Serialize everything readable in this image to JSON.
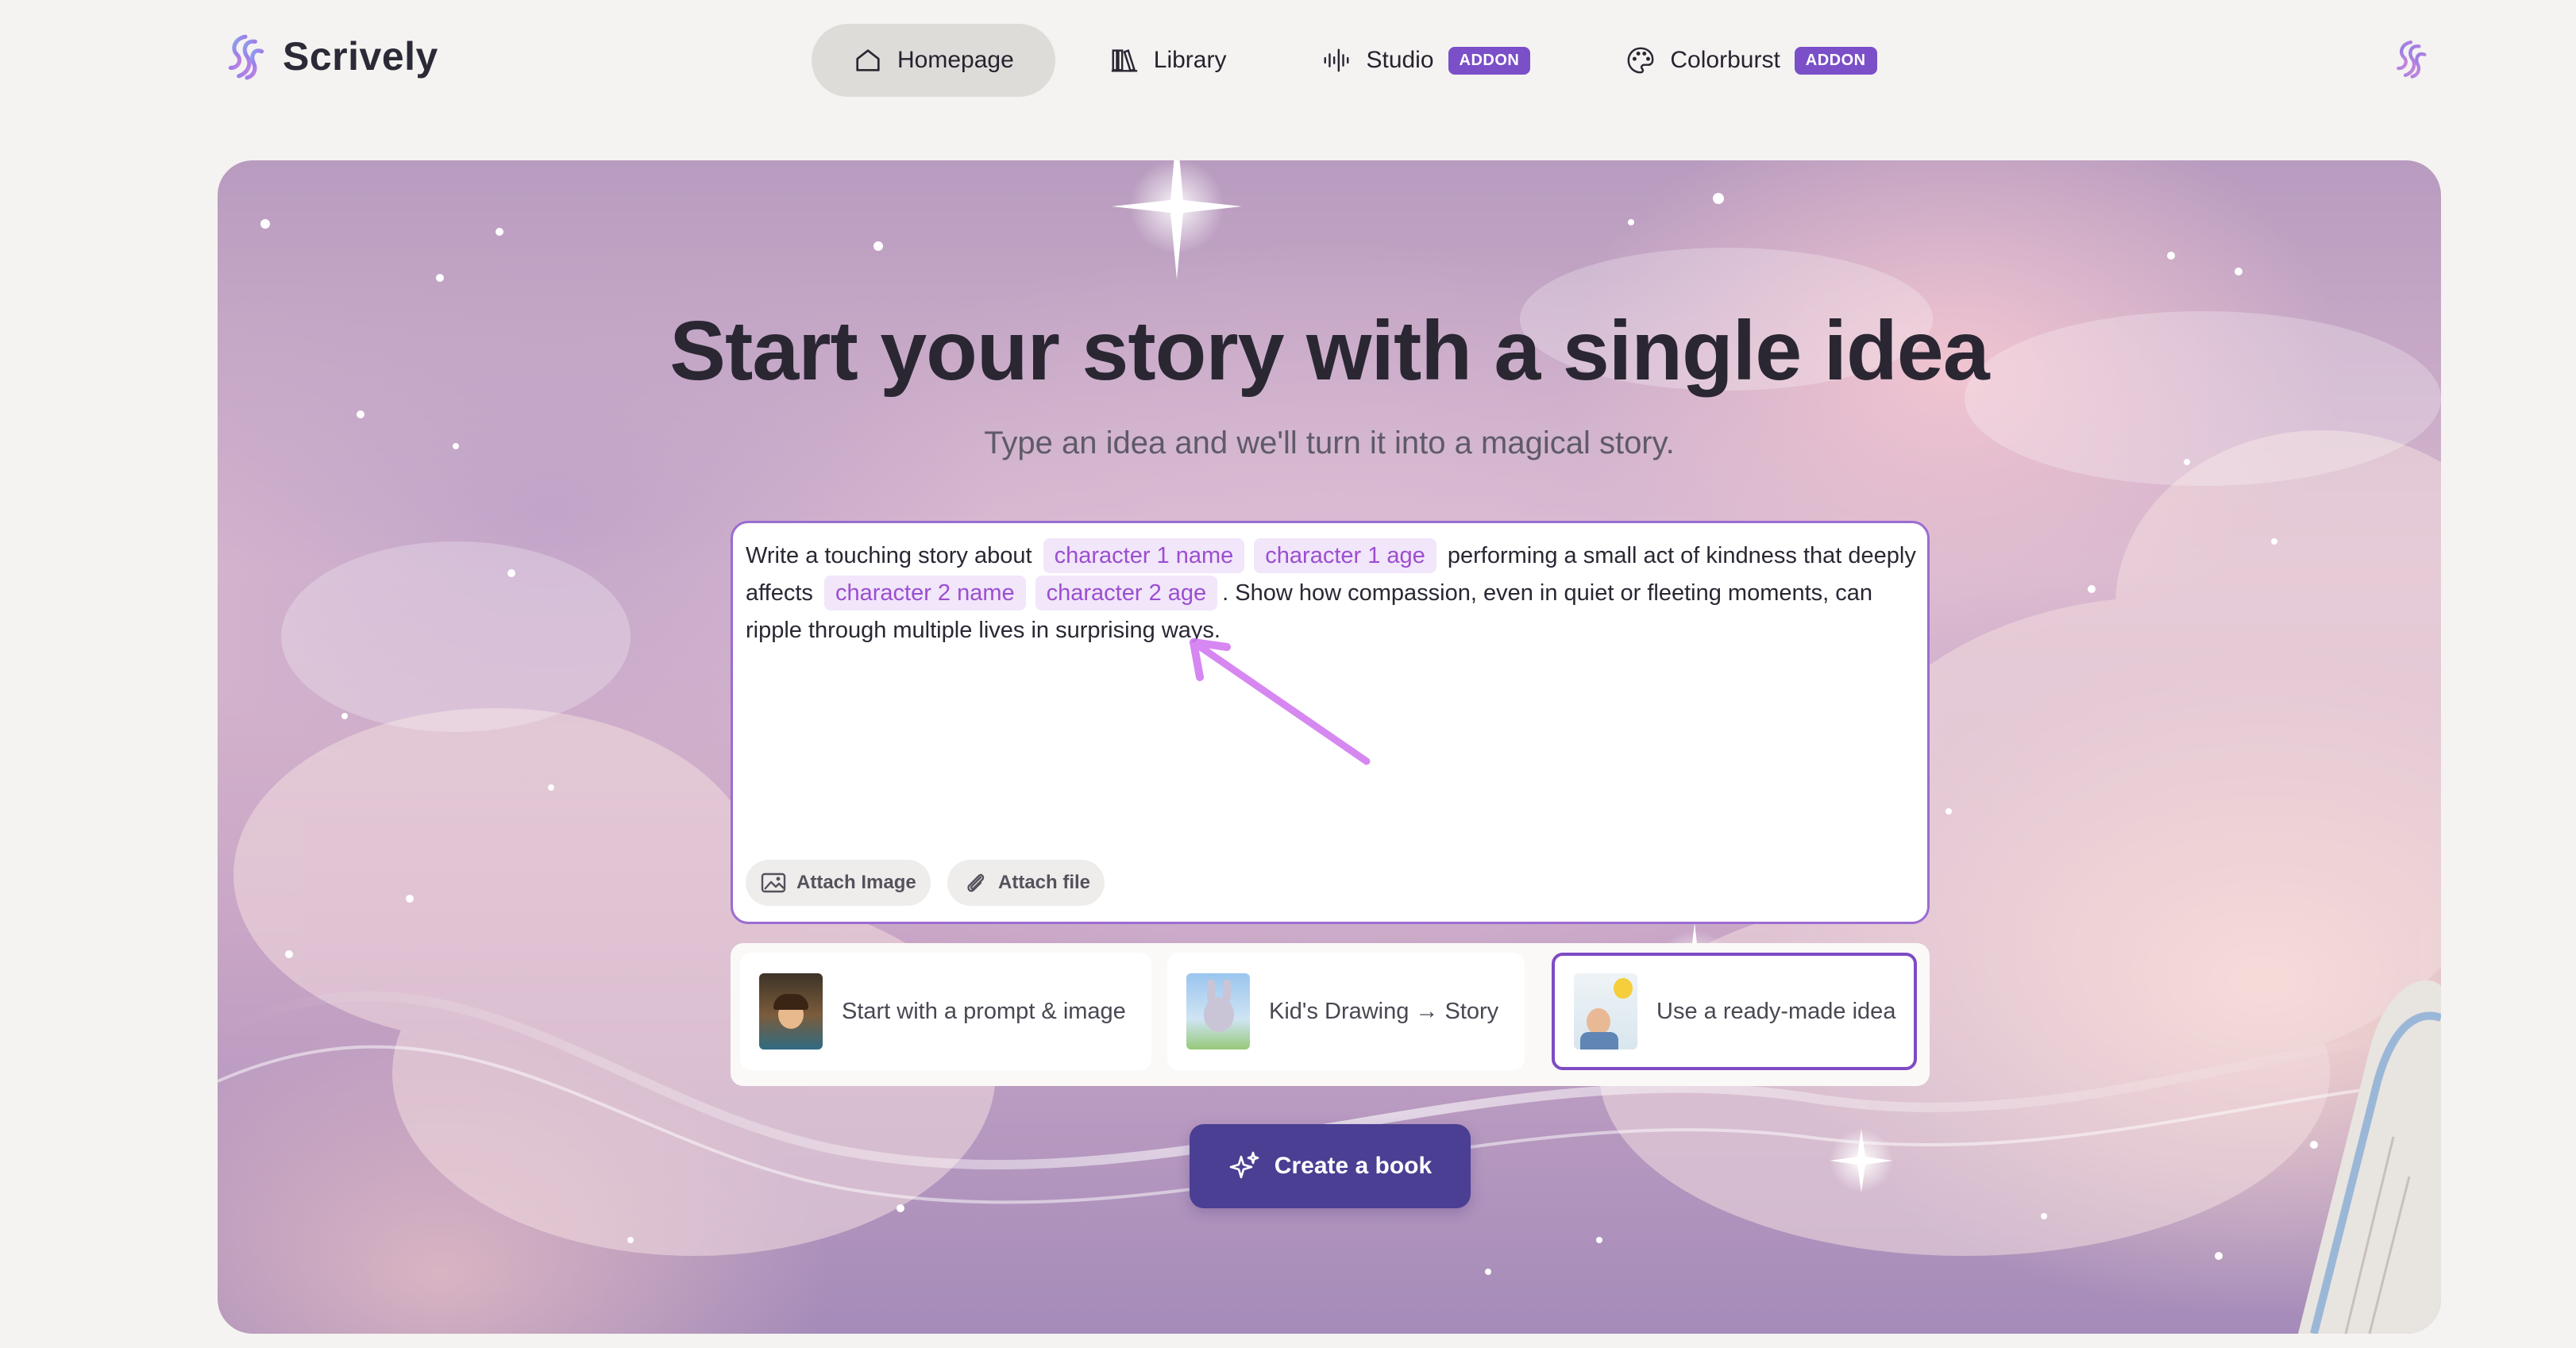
{
  "brand": {
    "name": "Scrively",
    "logo_icon": "swirl-logo-icon"
  },
  "nav": {
    "items": [
      {
        "label": "Homepage",
        "icon": "home-icon",
        "active": true
      },
      {
        "label": "Library",
        "icon": "books-icon"
      },
      {
        "label": "Studio",
        "icon": "audio-wave-icon",
        "badge": "ADDON"
      },
      {
        "label": "Colorburst",
        "icon": "palette-icon",
        "badge": "ADDON"
      }
    ],
    "right_icon": "swirl-logo-icon"
  },
  "hero": {
    "title": "Start your story with a single idea",
    "subtitle": "Type an idea and we'll turn it into a magical story."
  },
  "prompt": {
    "text_1": "Write a touching story about",
    "chip_1": "character 1 name",
    "chip_2": "character 1 age",
    "text_2": "performing a small act of kindness that deeply affects",
    "chip_3": "character 2 name",
    "chip_4": "character 2 age",
    "text_3": ". Show how compassion, even in quiet or fleeting moments, can ripple through multiple lives in surprising ways.",
    "attach_image": "Attach Image",
    "attach_file": "Attach file"
  },
  "modes": [
    {
      "label": "Start with a prompt & image",
      "selected": false
    },
    {
      "label": "Kid's Drawing → Story",
      "selected": false
    },
    {
      "label": "Use a ready-made idea",
      "selected": true
    }
  ],
  "cta": {
    "label": "Create a book",
    "icon": "sparkles-icon"
  },
  "colors": {
    "accent": "#7e4bc4",
    "chip_bg": "#f1e6fa",
    "chip_text": "#9c4ed0",
    "cta_bg": "#4a3f93",
    "addon_bg": "#7a4fc8"
  }
}
